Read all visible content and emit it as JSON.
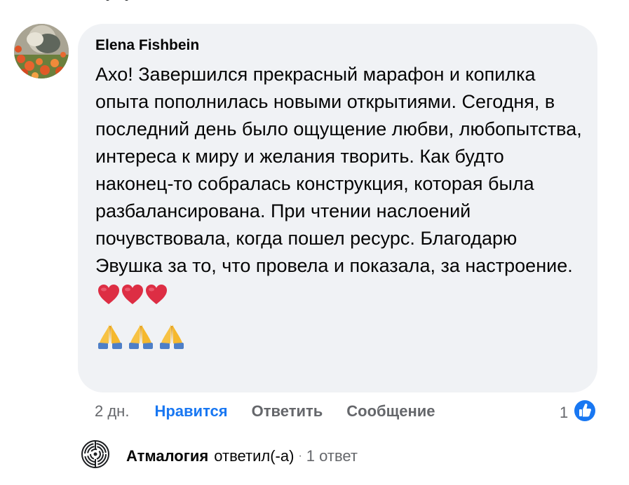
{
  "comment": {
    "author": "Elena Fishbein",
    "text": "Ахо! Завершился прекрасный марафон и копилка опыта пополнилась новыми открытиями. Сегодня, в последний день было ощущение любви, любопытства, интереса к миру и желания творить. Как будто наконец-то собралась конструкция, которая была разбалансирована. При чтении наслоений почувствовала, когда пошел ресурс. Благодарю Эвушка за то, что провела и показала, за настроение.",
    "emoji_hearts": [
      "red-heart-icon",
      "red-heart-icon",
      "red-heart-icon"
    ],
    "emoji_pray": [
      "folded-hands-icon",
      "folded-hands-icon",
      "folded-hands-icon"
    ]
  },
  "actions": {
    "time": "2 дн.",
    "like": "Нравится",
    "reply": "Ответить",
    "message": "Сообщение"
  },
  "reactions": {
    "count": "1",
    "icon": "thumbs-up-icon"
  },
  "reply_summary": {
    "name": "Атмалогия",
    "verb": "ответил(-а)",
    "separator": "·",
    "count": "1 ответ"
  },
  "colors": {
    "bubble_bg": "#f0f2f5",
    "accent_blue": "#1877f2",
    "secondary_text": "#65676b"
  }
}
